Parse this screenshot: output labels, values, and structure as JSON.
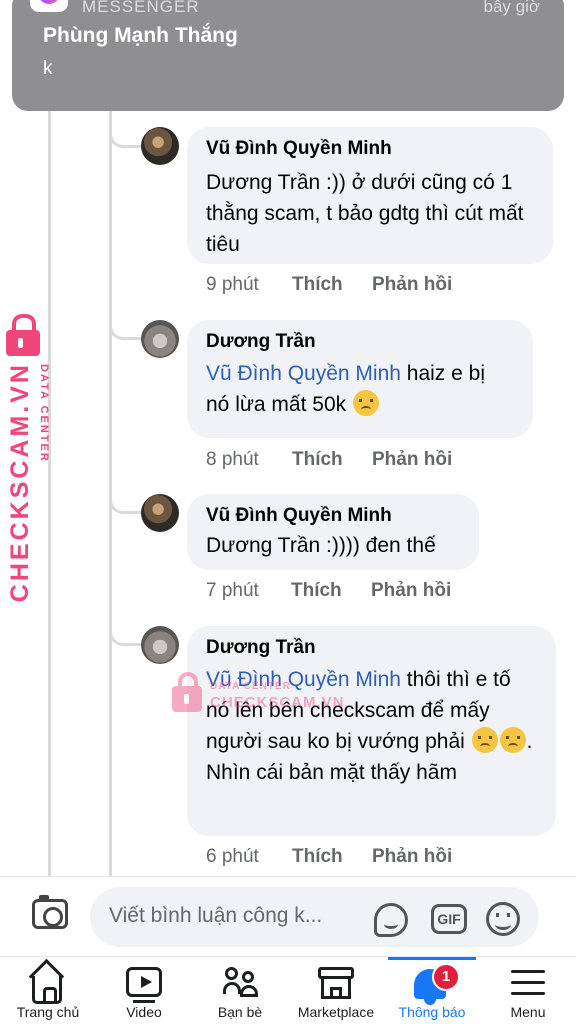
{
  "notification": {
    "app": "MESSENGER",
    "time": "bây giờ",
    "sender": "Phùng Mạnh Thắng",
    "message": "k"
  },
  "watermark": {
    "brand": "CHECKSCAM.VN",
    "tagline": "DATA CENTER"
  },
  "comments": [
    {
      "author": "Vũ Đình Quyền Minh",
      "text": "Dương Trần :)) ở dưới cũng có 1 thằng scam, t bảo gdtg thì cút mất tiêu",
      "time": "9 phút",
      "like_label": "Thích",
      "reply_label": "Phản hồi"
    },
    {
      "author": "Dương Trần",
      "mention": "Vũ Đình Quyền Minh",
      "text": " haiz e bị nó lừa mất 50k ",
      "emoji": "disappointed-face",
      "time": "8 phút",
      "like_label": "Thích",
      "reply_label": "Phản hồi"
    },
    {
      "author": "Vũ Đình Quyền Minh",
      "text": "Dương Trần :)))) đen thế",
      "time": "7 phút",
      "like_label": "Thích",
      "reply_label": "Phản hồi"
    },
    {
      "author": "Dương Trần",
      "mention": "Vũ Đình Quyền Minh",
      "text": " thôi thì e tố nó lên bên checkscam để mấy người sau ko bị vướng phải ",
      "text_after_emoji": ". Nhìn cái bản mặt thấy hãm",
      "emoji": "disappointed-face",
      "time": "6 phút",
      "like_label": "Thích",
      "reply_label": "Phản hồi"
    }
  ],
  "composer": {
    "placeholder": "Viết bình luận công k...",
    "gif_label": "GIF"
  },
  "bottom_nav": {
    "items": [
      {
        "label": "Trang chủ",
        "icon": "home-icon"
      },
      {
        "label": "Video",
        "icon": "video-icon"
      },
      {
        "label": "Bạn bè",
        "icon": "friends-icon"
      },
      {
        "label": "Marketplace",
        "icon": "marketplace-icon"
      },
      {
        "label": "Thông báo",
        "icon": "bell-icon",
        "active": true,
        "badge": "1"
      },
      {
        "label": "Menu",
        "icon": "menu-icon"
      }
    ],
    "active_color": "#1877f2"
  }
}
